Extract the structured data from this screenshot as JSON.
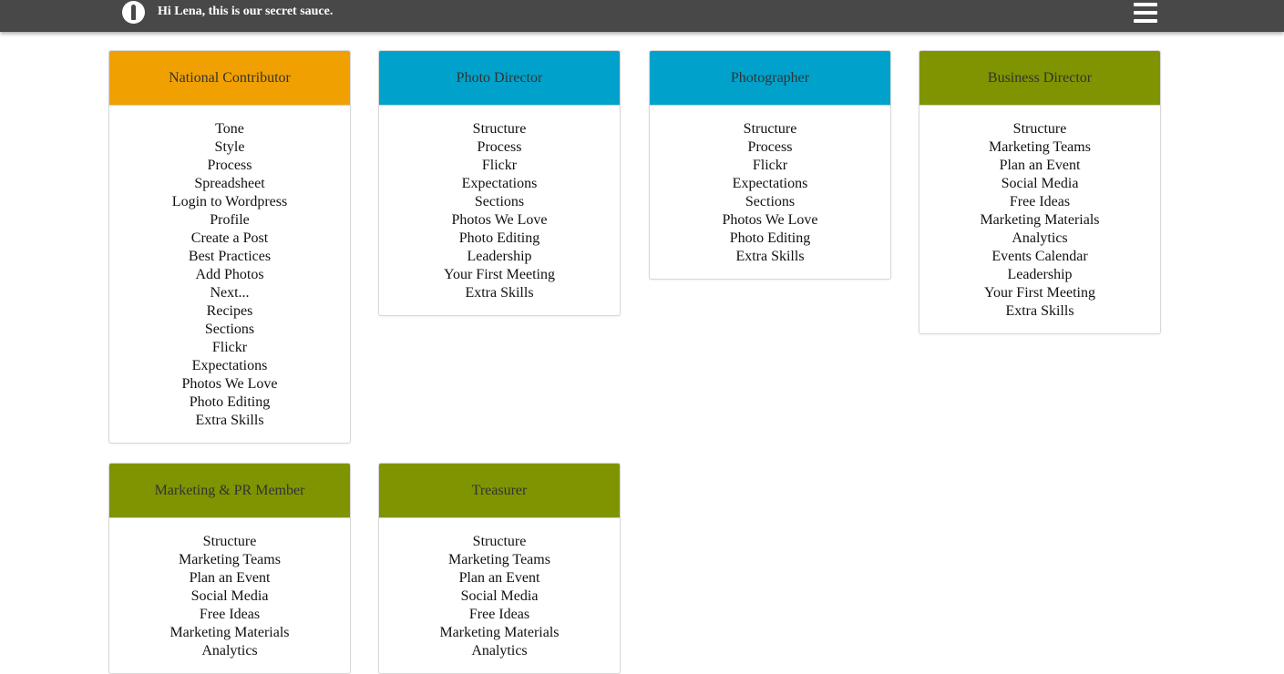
{
  "header": {
    "greeting": "Hi Lena, this is our secret sauce.",
    "logo_icon": "spoon-logo-icon",
    "menu_icon": "hamburger-menu-icon",
    "background": "#484848"
  },
  "cards": [
    {
      "title": "National Contributor",
      "color": "#f0a000",
      "links": [
        "Tone",
        "Style",
        "Process",
        "Spreadsheet",
        "Login to Wordpress",
        "Profile",
        "Create a Post",
        "Best Practices",
        "Add Photos",
        "Next...",
        "Recipes",
        "Sections",
        "Flickr",
        "Expectations",
        "Photos We Love",
        "Photo Editing",
        "Extra Skills"
      ]
    },
    {
      "title": "Photo Director",
      "color": "#00a2cb",
      "links": [
        "Structure",
        "Process",
        "Flickr",
        "Expectations",
        "Sections",
        "Photos We Love",
        "Photo Editing",
        "Leadership",
        "Your First Meeting",
        "Extra Skills"
      ]
    },
    {
      "title": "Photographer",
      "color": "#00a2cb",
      "links": [
        "Structure",
        "Process",
        "Flickr",
        "Expectations",
        "Sections",
        "Photos We Love",
        "Photo Editing",
        "Extra Skills"
      ]
    },
    {
      "title": "Business Director",
      "color": "#7f9400",
      "links": [
        "Structure",
        "Marketing Teams",
        "Plan an Event",
        "Social Media",
        "Free Ideas",
        "Marketing Materials",
        "Analytics",
        "Events Calendar",
        "Leadership",
        "Your First Meeting",
        "Extra Skills"
      ]
    },
    {
      "title": "Marketing & PR Member",
      "color": "#7f9400",
      "links": [
        "Structure",
        "Marketing Teams",
        "Plan an Event",
        "Social Media",
        "Free Ideas",
        "Marketing Materials",
        "Analytics"
      ]
    },
    {
      "title": "Treasurer",
      "color": "#7f9400",
      "links": [
        "Structure",
        "Marketing Teams",
        "Plan an Event",
        "Social Media",
        "Free Ideas",
        "Marketing Materials",
        "Analytics"
      ]
    }
  ]
}
